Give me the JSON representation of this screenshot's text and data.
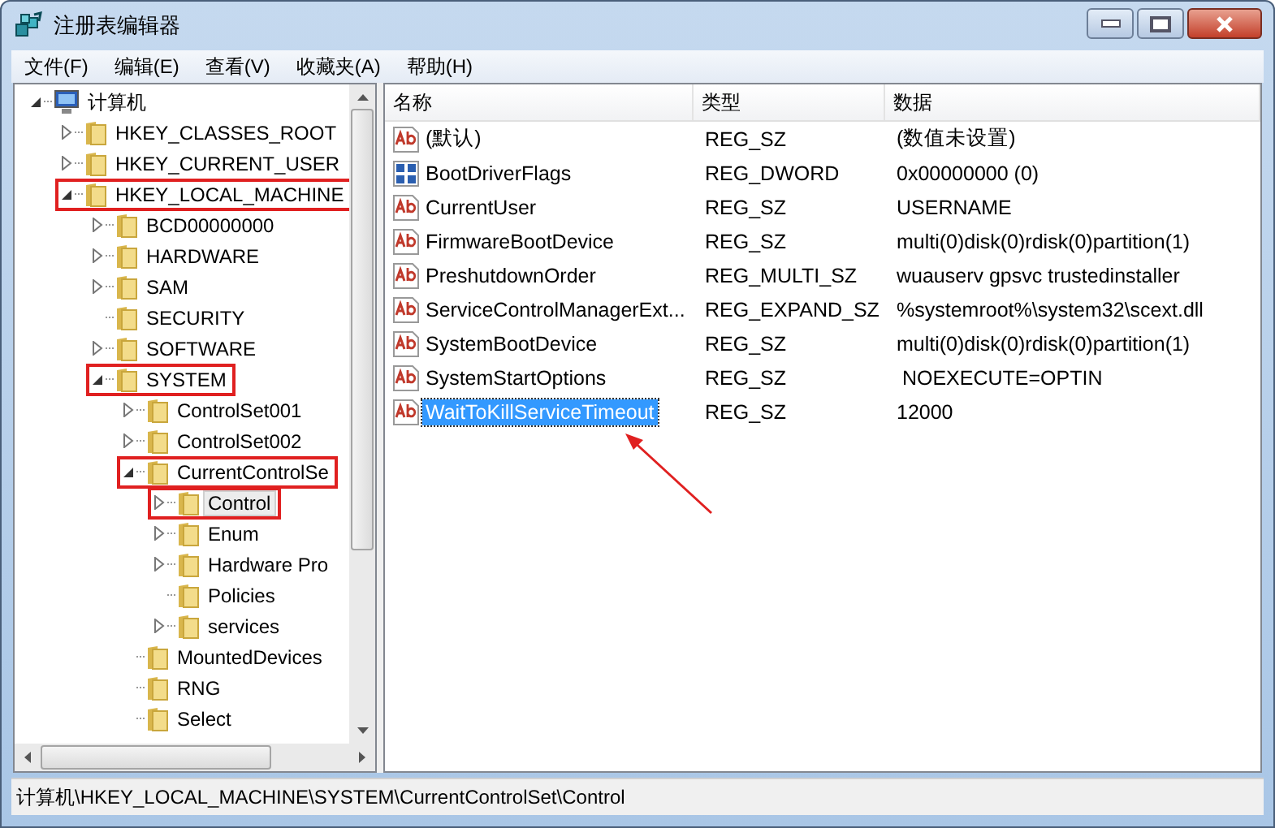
{
  "window": {
    "title": "注册表编辑器"
  },
  "menu": [
    "文件(F)",
    "编辑(E)",
    "查看(V)",
    "收藏夹(A)",
    "帮助(H)"
  ],
  "tree": [
    {
      "label": "计算机",
      "kind": "computer",
      "expanded": true,
      "selected": false,
      "highlighted": false,
      "children": [
        {
          "label": "HKEY_CLASSES_ROOT",
          "kind": "folder",
          "expanded": false,
          "selected": false,
          "highlighted": false
        },
        {
          "label": "HKEY_CURRENT_USER",
          "kind": "folder",
          "expanded": false,
          "selected": false,
          "highlighted": false
        },
        {
          "label": "HKEY_LOCAL_MACHINE",
          "kind": "folder",
          "expanded": true,
          "selected": false,
          "highlighted": true,
          "children": [
            {
              "label": "BCD00000000",
              "kind": "folder",
              "expanded": false,
              "selected": false,
              "highlighted": false
            },
            {
              "label": "HARDWARE",
              "kind": "folder",
              "expanded": false,
              "selected": false,
              "highlighted": false
            },
            {
              "label": "SAM",
              "kind": "folder",
              "expanded": false,
              "selected": false,
              "highlighted": false
            },
            {
              "label": "SECURITY",
              "kind": "folder",
              "selected": false,
              "highlighted": false
            },
            {
              "label": "SOFTWARE",
              "kind": "folder",
              "expanded": false,
              "selected": false,
              "highlighted": false
            },
            {
              "label": "SYSTEM",
              "kind": "folder",
              "expanded": true,
              "selected": false,
              "highlighted": true,
              "children": [
                {
                  "label": "ControlSet001",
                  "kind": "folder",
                  "expanded": false,
                  "selected": false,
                  "highlighted": false
                },
                {
                  "label": "ControlSet002",
                  "kind": "folder",
                  "expanded": false,
                  "selected": false,
                  "highlighted": false
                },
                {
                  "label": "CurrentControlSe",
                  "kind": "folder",
                  "expanded": true,
                  "selected": false,
                  "highlighted": true,
                  "children": [
                    {
                      "label": "Control",
                      "kind": "folder",
                      "expanded": false,
                      "selected": true,
                      "highlighted": true
                    },
                    {
                      "label": "Enum",
                      "kind": "folder",
                      "expanded": false,
                      "selected": false,
                      "highlighted": false
                    },
                    {
                      "label": "Hardware Pro",
                      "kind": "folder",
                      "expanded": false,
                      "selected": false,
                      "highlighted": false
                    },
                    {
                      "label": "Policies",
                      "kind": "folder",
                      "selected": false,
                      "highlighted": false
                    },
                    {
                      "label": "services",
                      "kind": "folder",
                      "expanded": false,
                      "selected": false,
                      "highlighted": false
                    }
                  ]
                },
                {
                  "label": "MountedDevices",
                  "kind": "folder",
                  "selected": false,
                  "highlighted": false
                },
                {
                  "label": "RNG",
                  "kind": "folder",
                  "selected": false,
                  "highlighted": false
                },
                {
                  "label": "Select",
                  "kind": "folder",
                  "selected": false,
                  "highlighted": false
                }
              ]
            }
          ]
        }
      ]
    }
  ],
  "table": {
    "columns": [
      "名称",
      "类型",
      "数据"
    ],
    "rows": [
      {
        "kind": "string",
        "name": "(默认)",
        "type": "REG_SZ",
        "data": "(数值未设置)",
        "selected": false
      },
      {
        "kind": "binary",
        "name": "BootDriverFlags",
        "type": "REG_DWORD",
        "data": "0x00000000 (0)",
        "selected": false
      },
      {
        "kind": "string",
        "name": "CurrentUser",
        "type": "REG_SZ",
        "data": "USERNAME",
        "selected": false
      },
      {
        "kind": "string",
        "name": "FirmwareBootDevice",
        "type": "REG_SZ",
        "data": "multi(0)disk(0)rdisk(0)partition(1)",
        "selected": false
      },
      {
        "kind": "string",
        "name": "PreshutdownOrder",
        "type": "REG_MULTI_SZ",
        "data": "wuauserv gpsvc trustedinstaller",
        "selected": false
      },
      {
        "kind": "string",
        "name": "ServiceControlManagerExt...",
        "type": "REG_EXPAND_SZ",
        "data": "%systemroot%\\system32\\scext.dll",
        "selected": false
      },
      {
        "kind": "string",
        "name": "SystemBootDevice",
        "type": "REG_SZ",
        "data": "multi(0)disk(0)rdisk(0)partition(1)",
        "selected": false
      },
      {
        "kind": "string",
        "name": "SystemStartOptions",
        "type": "REG_SZ",
        "data": " NOEXECUTE=OPTIN",
        "selected": false
      },
      {
        "kind": "string",
        "name": "WaitToKillServiceTimeout",
        "type": "REG_SZ",
        "data": "12000",
        "selected": true
      }
    ]
  },
  "status_bar": "计算机\\HKEY_LOCAL_MACHINE\\SYSTEM\\CurrentControlSet\\Control"
}
